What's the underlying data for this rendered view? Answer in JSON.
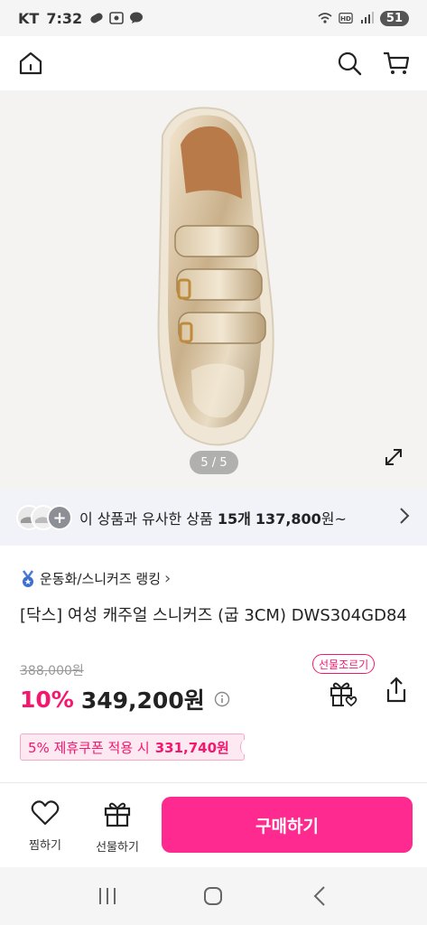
{
  "status_bar": {
    "carrier": "KT",
    "time": "7:32",
    "battery": "51",
    "icons": [
      "pill-icon",
      "screen-record-icon",
      "talk-icon",
      "wifi-icon",
      "hd-icon",
      "signal-icon"
    ]
  },
  "top_nav": {
    "icons": [
      "home-icon",
      "search-icon",
      "cart-icon"
    ]
  },
  "gallery": {
    "indicator": "5 / 5"
  },
  "similar": {
    "prefix": "이 상품과 유사한 상품 ",
    "count": "15개",
    "price": "137,800",
    "suffix": "원~"
  },
  "ranking": {
    "label": "운동화/스니커즈 랭킹",
    "chevron": "›"
  },
  "product": {
    "title": "[닥스] 여성 캐주얼 스니커즈 (굽 3CM) DWS304GD84",
    "original_price": "388,000원",
    "discount": "10%",
    "price": "349,200원",
    "gift_tag": "선물조르기",
    "coupon_prefix": "5% 제휴쿠폰 적용 시",
    "coupon_price": "331,740원"
  },
  "action_bar": {
    "wish_label": "찜하기",
    "gift_label": "선물하기",
    "buy_label": "구매하기"
  },
  "colors": {
    "accent": "#f5166e",
    "buy_button": "#ff2a8f"
  }
}
